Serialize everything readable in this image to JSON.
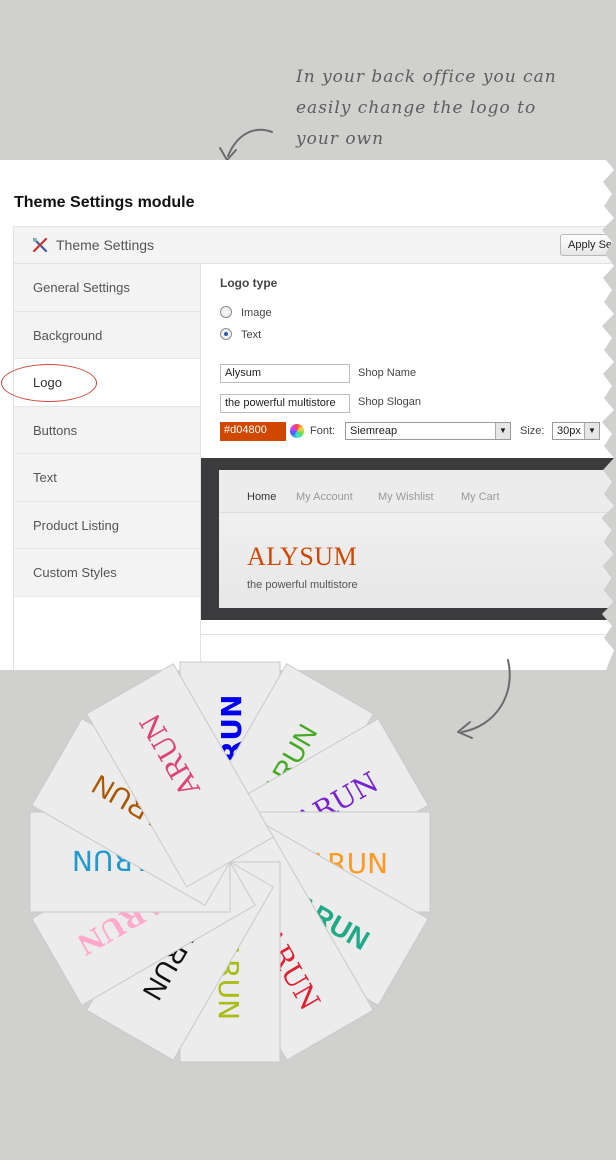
{
  "annotation": {
    "lines": [
      "In your back office you can",
      "easily change the logo to",
      "your own"
    ]
  },
  "module": {
    "title": "Theme Settings module",
    "header_title": "Theme Settings",
    "apply_button": "Apply Se"
  },
  "sidebar": {
    "items": [
      {
        "label": "General Settings"
      },
      {
        "label": "Background"
      },
      {
        "label": "Logo"
      },
      {
        "label": "Buttons"
      },
      {
        "label": "Text"
      },
      {
        "label": "Product Listing"
      },
      {
        "label": "Custom Styles"
      }
    ],
    "active": "Logo"
  },
  "logo_settings": {
    "section_title": "Logo type",
    "options": [
      {
        "label": "Image",
        "checked": false
      },
      {
        "label": "Text",
        "checked": true
      }
    ],
    "shop_name_value": "Alysum",
    "shop_name_label": "Shop Name",
    "shop_slogan_value": "the powerful multistore",
    "shop_slogan_label": "Shop Slogan",
    "color_value": "#d04800",
    "font_label": "Font:",
    "font_value": "Siemreap",
    "size_label": "Size:",
    "size_value": "30px"
  },
  "preview": {
    "nav": [
      "Home",
      "My Account",
      "My Wishlist",
      "My Cart"
    ],
    "logo_text": "ALYSUM",
    "slogan": "the powerful multistore"
  },
  "logo_samples": {
    "text": "ARUN",
    "colors": [
      "#0000ee",
      "#44aa22",
      "#7722cc",
      "#ff9922",
      "#22aa88",
      "#dd2233",
      "#aabb11",
      "#111111",
      "#ffaacc",
      "#2299cc",
      "#aa5500",
      "#dd4477"
    ]
  }
}
